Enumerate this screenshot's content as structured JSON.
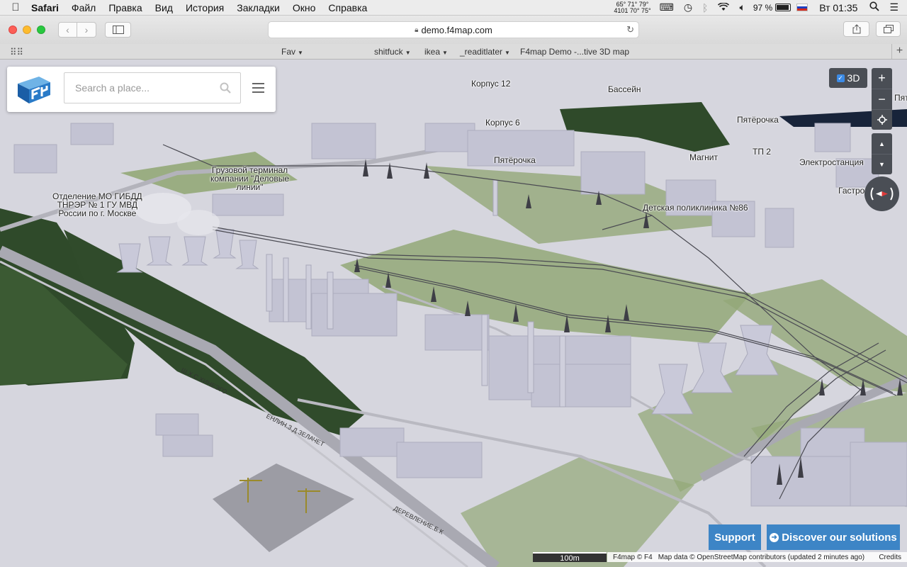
{
  "menubar": {
    "app_name": "Safari",
    "items": [
      "Файл",
      "Правка",
      "Вид",
      "История",
      "Закладки",
      "Окно",
      "Справка"
    ],
    "weather_top": "65°  71°  79°",
    "weather_bottom": "4101  70°  75°",
    "battery": "97 %",
    "clock": "Вт 01:35"
  },
  "browser": {
    "url": "demo.f4map.com",
    "bookmarks": [
      {
        "label": "Fav",
        "has_menu": true
      },
      {
        "label": "shitfuck",
        "has_menu": true
      },
      {
        "label": "ikea",
        "has_menu": true
      },
      {
        "label": "_readitlater",
        "has_menu": true
      },
      {
        "label": "F4map Demo -...tive 3D map",
        "has_menu": false
      }
    ]
  },
  "map": {
    "search": {
      "placeholder": "Search a place..."
    },
    "toggle_3d": {
      "label": "3D",
      "checked": true
    },
    "controls": {
      "zoom_in": "+",
      "zoom_out": "−"
    },
    "labels": [
      {
        "text": "Корпус 12"
      },
      {
        "text": "Бассейн"
      },
      {
        "text": "Пят"
      },
      {
        "text": "Корпус 6"
      },
      {
        "text": "Пятёрочка"
      },
      {
        "text": "Пятёрочка"
      },
      {
        "text": "Магнит"
      },
      {
        "text": "ТП 2"
      },
      {
        "text": "Электростанция"
      },
      {
        "text": "Гастро"
      },
      {
        "text": "Грузовой терминал\nкомпании \"Деловые\nлинии\""
      },
      {
        "text": "Отделение МО ГИБДД\nТНРЭР № 1 ГУ МВД\nРоссии по г. Москве"
      },
      {
        "text": "Детская поликлиника №86"
      }
    ],
    "scale": "100m",
    "attribution": {
      "f4": "F4map © F4",
      "osm": "Map data © OpenStreetMap contributors (updated 2 minutes ago)",
      "credits": "Credits"
    },
    "buttons": {
      "support": "Support",
      "solutions": "Discover our solutions"
    }
  }
}
